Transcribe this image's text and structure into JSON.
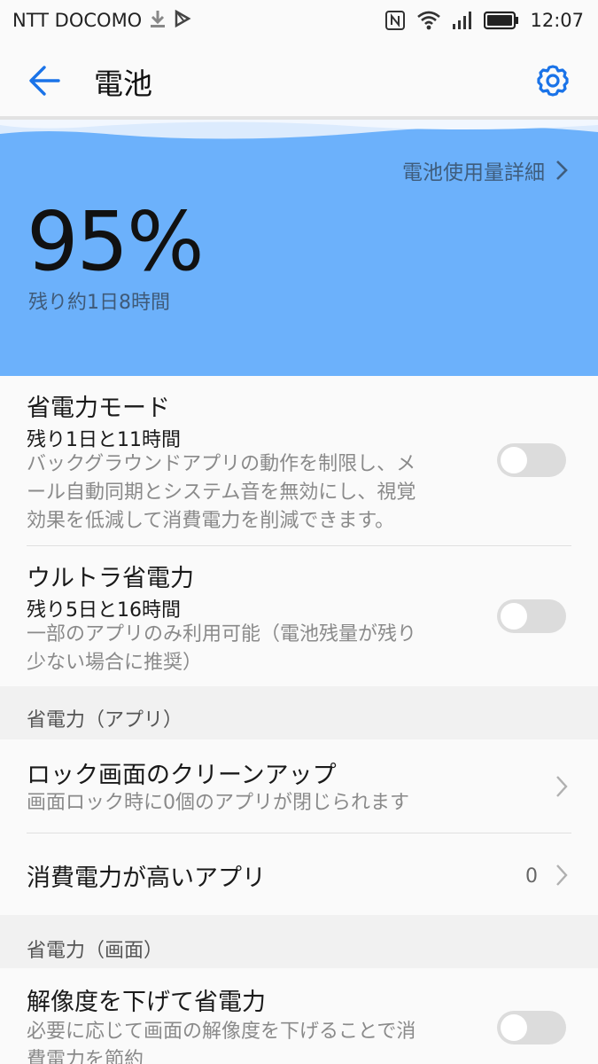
{
  "status_bar": {
    "carrier": "NTT DOCOMO",
    "time": "12:07"
  },
  "header": {
    "title": "電池"
  },
  "battery": {
    "usage_link": "電池使用量詳細",
    "percent": "95%",
    "remaining": "残り約1日8時間"
  },
  "power_saving": {
    "title": "省電力モード",
    "remaining": "残り1日と11時間",
    "desc_line1": "バックグラウンドアプリの動作を制限し、メ",
    "desc_line2": "ール自動同期とシステム音を無効にし、視覚",
    "desc_line3": "効果を低減して消費電力を削減できます。",
    "enabled": false
  },
  "ultra_saving": {
    "title": "ウルトラ省電力",
    "remaining": "残り5日と16時間",
    "desc_line1": "一部のアプリのみ利用可能（電池残量が残り",
    "desc_line2": "少ない場合に推奨）",
    "enabled": false
  },
  "section_apps": {
    "label": "省電力（アプリ）"
  },
  "lock_cleanup": {
    "title": "ロック画面のクリーンアップ",
    "desc": "画面ロック時に0個のアプリが閉じられます"
  },
  "high_power_apps": {
    "title": "消費電力が高いアプリ",
    "count": "0"
  },
  "section_screen": {
    "label": "省電力（画面）"
  },
  "resolution": {
    "title": "解像度を下げて省電力",
    "desc_line1": "必要に応じて画面の解像度を下げることで消",
    "desc_line2": "費電力を節約",
    "enabled": false
  },
  "colors": {
    "accent": "#1a73e8",
    "battery_panel": "#6cb1fb"
  }
}
